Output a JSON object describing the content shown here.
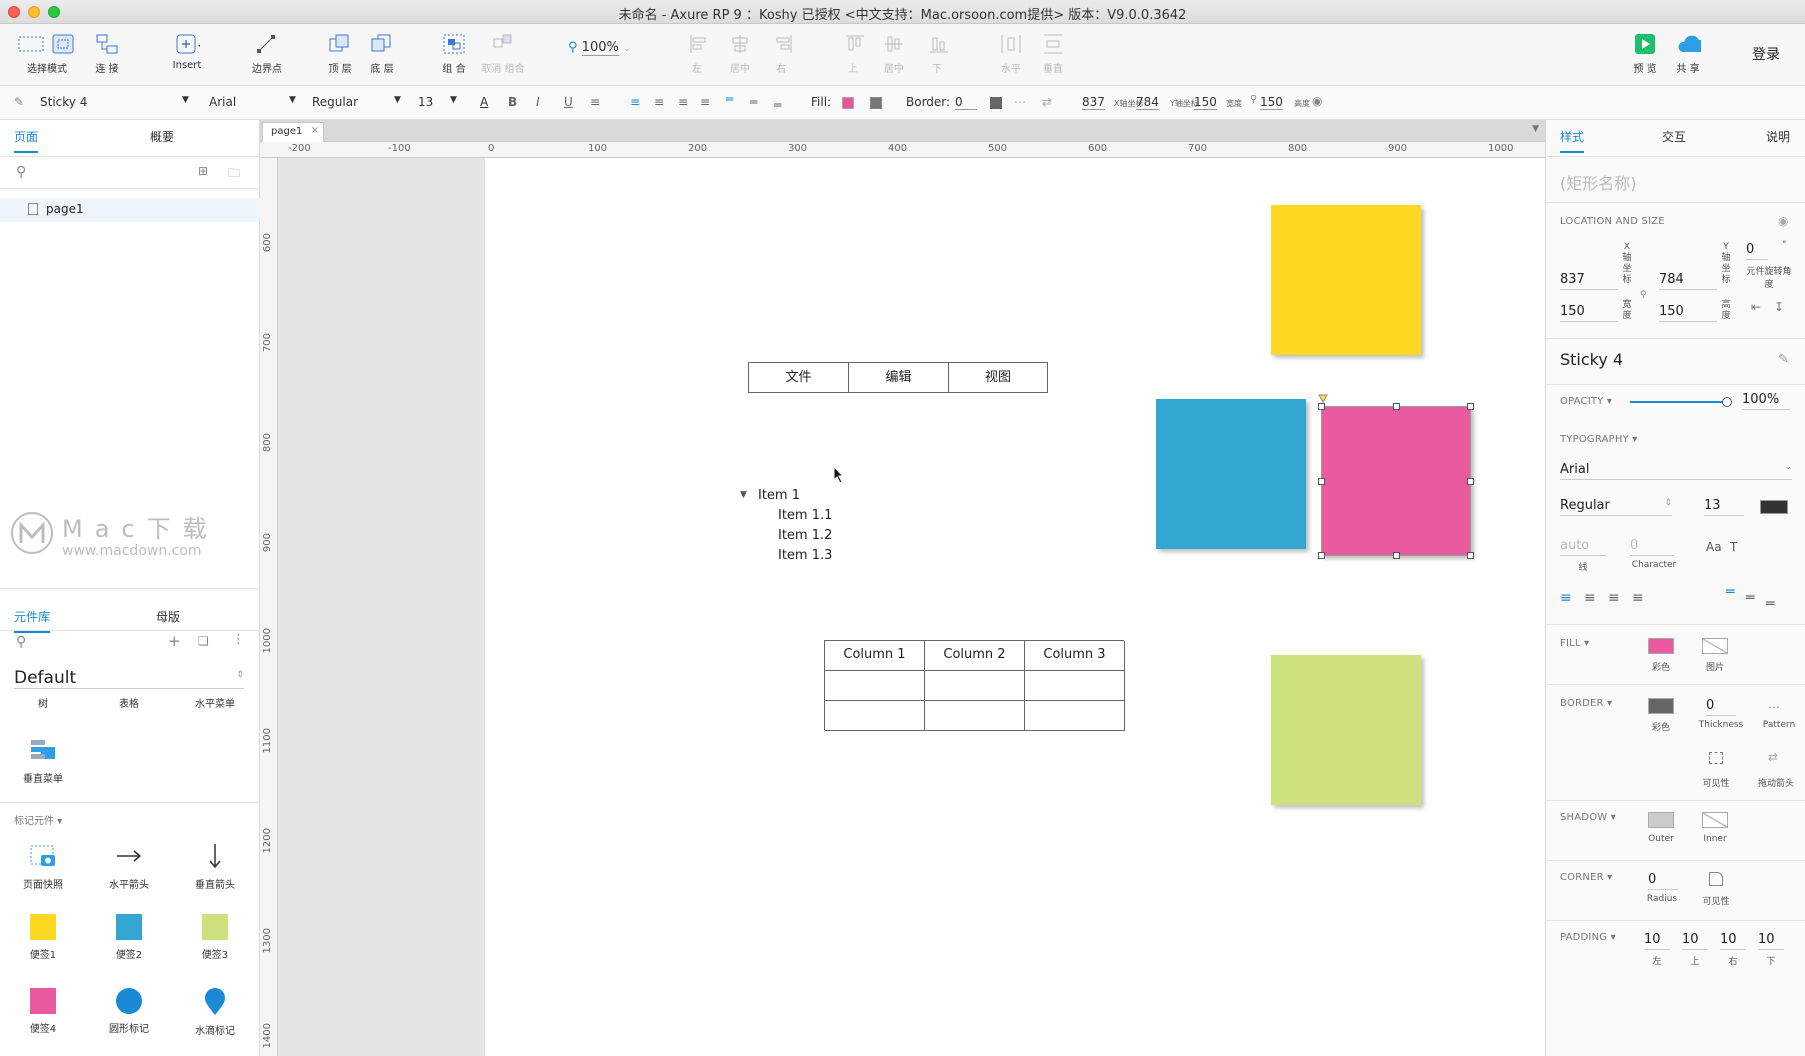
{
  "window": {
    "title": "未命名 - Axure RP 9 ：Koshy 已授权    <中文支持：Mac.orsoon.com提供> 版本：V9.0.0.3642"
  },
  "toolbar": {
    "select_mode": "选择模式",
    "connect": "连 接",
    "insert": "Insert",
    "points": "边界点",
    "top": "顶 层",
    "bottom": "底 层",
    "group": "组 合",
    "ungroup": "取消 组合",
    "zoom": "100%",
    "align_left": "左",
    "align_center": "居中",
    "align_right": "右",
    "align_top": "上",
    "align_middle": "居中",
    "align_bottom": "下",
    "dist_h": "水平",
    "dist_v": "垂直",
    "preview": "预 览",
    "share": "共 享",
    "login": "登录"
  },
  "formatbar": {
    "style_name": "Sticky 4",
    "font": "Arial",
    "weight": "Regular",
    "size": "13",
    "fill_label": "Fill:",
    "border_label": "Border:",
    "border_value": "0",
    "x": "837",
    "x_label": "X轴坐标",
    "y": "784",
    "y_label": "Y轴坐标",
    "w": "150",
    "w_label": "宽度",
    "h": "150",
    "h_label": "高度",
    "fill_color": "#e8559b"
  },
  "left": {
    "tab_pages": "页面",
    "tab_outline": "概要",
    "page_item": "page1",
    "tab_library": "元件库",
    "tab_masters": "母版",
    "library_name": "Default",
    "lib_row1": [
      "树",
      "表格",
      "水平菜单"
    ],
    "lib_vmenu": "垂直菜单",
    "markup_label": "标记元件 ▾",
    "markup_items": [
      "页面快照",
      "水平箭头",
      "垂直箭头",
      "便签1",
      "便签2",
      "便签3",
      "便签4",
      "圆形标记",
      "水滴标记"
    ],
    "watermark": "Mac下载",
    "watermark_url": "www.macdown.com"
  },
  "canvas": {
    "tab": "page1",
    "hruler": [
      "-200",
      "-100",
      "0",
      "100",
      "200",
      "300",
      "400",
      "500",
      "600",
      "700",
      "800",
      "900",
      "1000"
    ],
    "vruler": [
      "600",
      "700",
      "800",
      "900",
      "1000",
      "1100",
      "1200",
      "1300",
      "1400"
    ],
    "menu": [
      "文件",
      "编辑",
      "视图"
    ],
    "tree_root": "Item 1",
    "tree_children": [
      "Item 1.1",
      "Item 1.2",
      "Item 1.3"
    ],
    "table_headers": [
      "Column 1",
      "Column 2",
      "Column 3"
    ],
    "sticky_colors": {
      "yellow": "#fdd923",
      "blue": "#33a6d1",
      "pink": "#ea5a9f",
      "green": "#cfe07e"
    }
  },
  "right": {
    "tab_style": "样式",
    "tab_interact": "交互",
    "tab_notes": "说明",
    "shape_name_placeholder": "(矩形名称)",
    "loc_size": "LOCATION AND SIZE",
    "x": "837",
    "y": "784",
    "w": "150",
    "h": "150",
    "rotation": "0",
    "rotation_unit": "°",
    "x_lbl": "X轴坐标",
    "y_lbl": "Y轴坐标",
    "w_lbl": "宽度",
    "h_lbl": "高度",
    "rot_lbl": "元件旋转角度",
    "style_name": "Sticky 4",
    "opacity_label": "OPACITY ▾",
    "opacity": "100%",
    "typography_label": "TYPOGRAPHY ▾",
    "font": "Arial",
    "weight": "Regular",
    "size": "13",
    "line_auto": "auto",
    "line_lbl": "线",
    "char_val": "0",
    "char_lbl": "Character",
    "fill_label": "FILL ▾",
    "fill_color_lbl": "彩色",
    "fill_image_lbl": "图片",
    "border_label": "BORDER ▾",
    "border_color_lbl": "彩色",
    "thickness": "0",
    "thickness_lbl": "Thickness",
    "pattern_lbl": "Pattern",
    "visibility_lbl": "可见性",
    "arrow_lbl": "拖动箭头",
    "shadow_label": "SHADOW ▾",
    "outer_lbl": "Outer",
    "inner_lbl": "Inner",
    "corner_label": "CORNER ▾",
    "radius": "0",
    "radius_lbl": "Radius",
    "corner_vis_lbl": "可见性",
    "padding_label": "PADDING ▾",
    "padding": [
      "10",
      "10",
      "10",
      "10"
    ],
    "padding_lbls": [
      "左",
      "上",
      "右",
      "下"
    ]
  }
}
